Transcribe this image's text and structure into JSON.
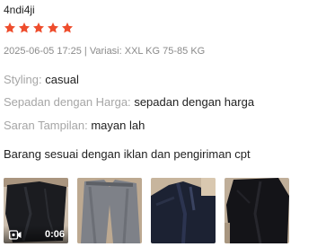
{
  "review": {
    "username": "4ndi4ji",
    "rating": 5,
    "rating_max": 5,
    "star_color": "#ee4d2d",
    "meta": "2025-06-05 17:25 | Variasi: XXL KG 75-85 KG",
    "attributes": [
      {
        "label": "Styling:",
        "value": "casual"
      },
      {
        "label": "Sepadan dengan Harga:",
        "value": "sepadan dengan harga"
      },
      {
        "label": "Saran Tampilan:",
        "value": "mayan lah"
      }
    ],
    "comment": "Barang sesuai dengan iklan dan pengiriman cpt",
    "media": [
      {
        "type": "video",
        "icon": "video-camera-icon",
        "duration": "0:06"
      },
      {
        "type": "image"
      },
      {
        "type": "image"
      },
      {
        "type": "image"
      }
    ]
  }
}
